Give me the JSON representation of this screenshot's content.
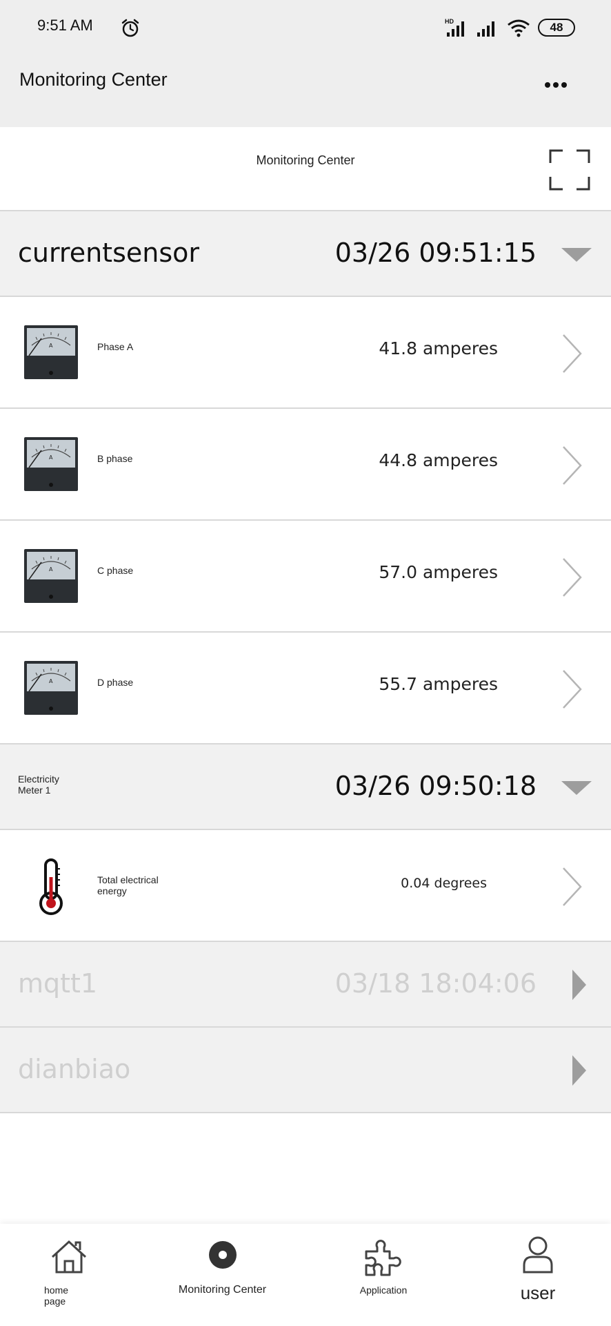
{
  "status": {
    "time": "9:51 AM",
    "network_label": "HD",
    "battery": "48"
  },
  "appbar": {
    "title": "Monitoring Center",
    "more_icon": "more-dots-icon"
  },
  "header": {
    "title": "Monitoring Center",
    "scan_icon": "scan-icon"
  },
  "groups": [
    {
      "name": "currentsensor",
      "time": "03/26 09:51:15",
      "expanded": true,
      "items": [
        {
          "label": "Phase A",
          "value": "41.8 amperes",
          "icon": "ammeter-icon"
        },
        {
          "label": "B phase",
          "value": "44.8 amperes",
          "icon": "ammeter-icon"
        },
        {
          "label": "C phase",
          "value": "57.0 amperes",
          "icon": "ammeter-icon"
        },
        {
          "label": "D phase",
          "value": "55.7 amperes",
          "icon": "ammeter-icon"
        }
      ]
    },
    {
      "name": "Electricity Meter 1",
      "time": "03/26 09:50:18",
      "expanded": true,
      "items": [
        {
          "label": "Total electrical energy",
          "value": "0.04 degrees",
          "icon": "thermometer-icon"
        }
      ]
    },
    {
      "name": "mqtt1",
      "time": "03/18 18:04:06",
      "expanded": false,
      "items": []
    },
    {
      "name": "dianbiao",
      "time": "",
      "expanded": false,
      "items": []
    }
  ],
  "nav": [
    {
      "label": "home page",
      "icon": "home-icon"
    },
    {
      "label": "Monitoring Center",
      "icon": "monitor-icon"
    },
    {
      "label": "Application",
      "icon": "puzzle-icon"
    },
    {
      "label": "user",
      "icon": "user-icon"
    }
  ],
  "colors": {
    "topbar_bg": "#eeeeee",
    "group_bg": "#f1f1f1",
    "divider": "#d8d8d8",
    "dim_text": "#cfcfcf",
    "thermometer_red": "#c0141c"
  }
}
